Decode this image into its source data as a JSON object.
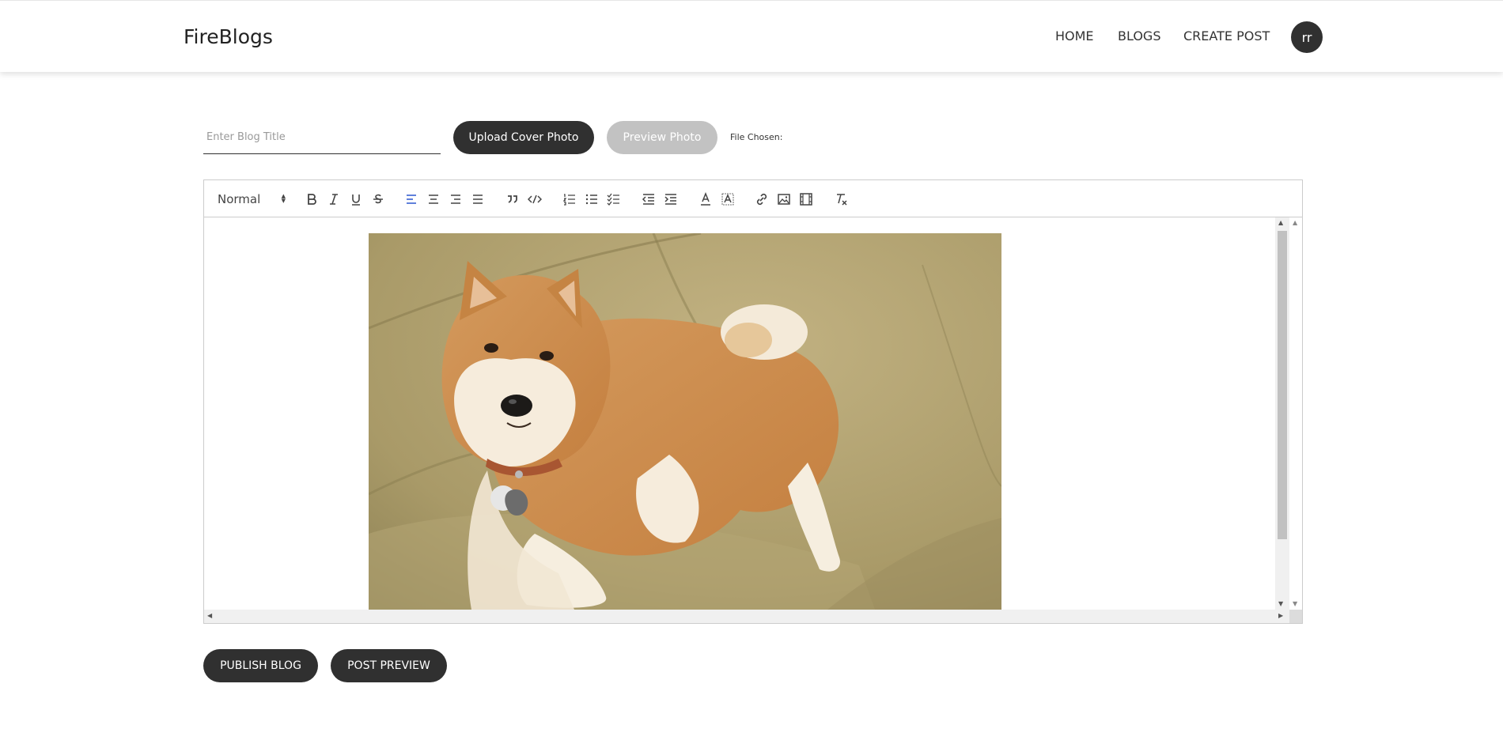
{
  "header": {
    "logo": "FireBlogs",
    "nav": [
      "HOME",
      "BLOGS",
      "CREATE POST"
    ],
    "avatar_initials": "rr"
  },
  "form": {
    "title_placeholder": "Enter Blog Title",
    "title_value": "",
    "upload_label": "Upload Cover Photo",
    "preview_label": "Preview Photo",
    "file_chosen_label": "File Chosen:"
  },
  "editor": {
    "header_select_value": "Normal",
    "toolbar_icons": [
      "bold-icon",
      "italic-icon",
      "underline-icon",
      "strike-icon",
      "align-left-icon",
      "align-center-icon",
      "align-right-icon",
      "align-justify-icon",
      "blockquote-icon",
      "code-block-icon",
      "ordered-list-icon",
      "bullet-list-icon",
      "check-list-icon",
      "outdent-icon",
      "indent-icon",
      "text-color-icon",
      "background-color-icon",
      "link-icon",
      "image-icon",
      "video-icon",
      "clean-format-icon"
    ],
    "content_image": "shiba-inu-dog-on-couch"
  },
  "actions": {
    "publish_label": "PUBLISH BLOG",
    "preview_label": "POST PREVIEW"
  },
  "colors": {
    "primary_dark": "#303030",
    "disabled": "#c2c2c2",
    "active_icon": "#4a6fd6"
  }
}
